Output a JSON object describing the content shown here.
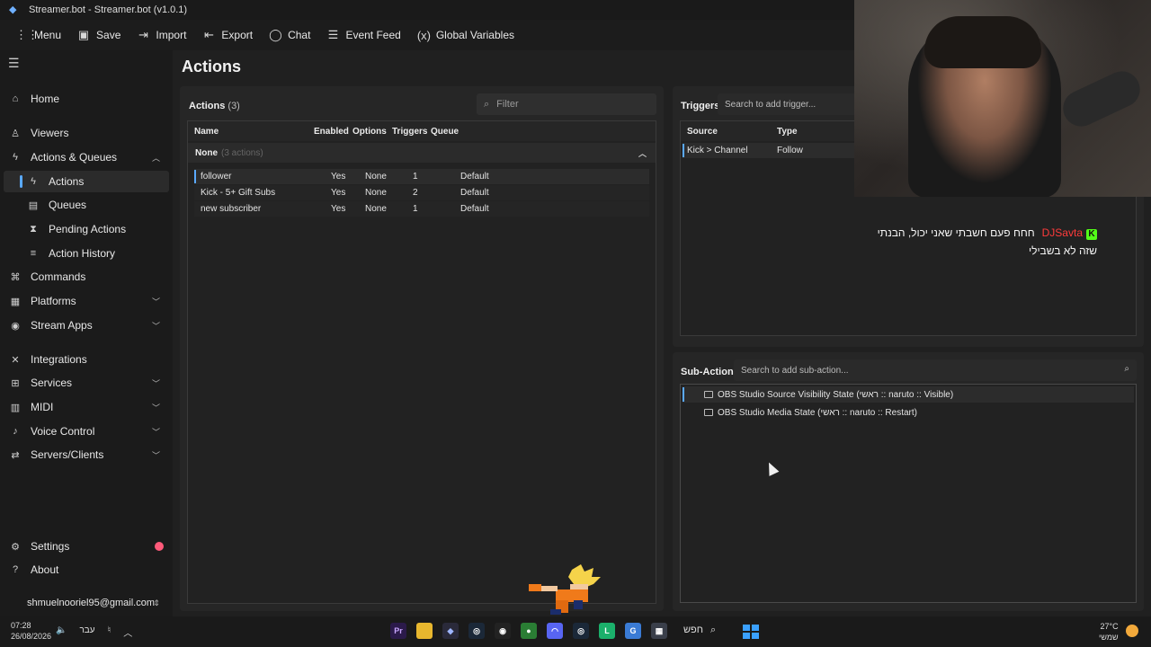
{
  "window": {
    "title": "Streamer.bot - Streamer.bot (v1.0.1)"
  },
  "toolbar": {
    "menu": "Menu",
    "save": "Save",
    "import": "Import",
    "export": "Export",
    "chat": "Chat",
    "event_feed": "Event Feed",
    "global_variables": "Global Variables"
  },
  "sidebar": {
    "items": [
      {
        "label": "Home"
      },
      {
        "label": "Viewers"
      },
      {
        "label": "Actions & Queues"
      },
      {
        "label": "Actions"
      },
      {
        "label": "Queues"
      },
      {
        "label": "Pending Actions"
      },
      {
        "label": "Action History"
      },
      {
        "label": "Commands"
      },
      {
        "label": "Platforms"
      },
      {
        "label": "Stream Apps"
      },
      {
        "label": "Integrations"
      },
      {
        "label": "Services"
      },
      {
        "label": "MIDI"
      },
      {
        "label": "Voice Control"
      },
      {
        "label": "Servers/Clients"
      }
    ],
    "settings": "Settings",
    "about": "About",
    "account": "shmuelnooriel95@gmail.com"
  },
  "page": {
    "title": "Actions"
  },
  "actions_panel": {
    "heading": "Actions",
    "count": "(3)",
    "filter_placeholder": "Filter",
    "columns": [
      "Name",
      "Enabled",
      "Options",
      "Triggers",
      "Queue"
    ],
    "group": {
      "name": "None",
      "count": "(3 actions)"
    },
    "rows": [
      {
        "name": "follower",
        "enabled": "Yes",
        "options": "None",
        "triggers": "1",
        "queue": "Default"
      },
      {
        "name": "Kick - 5+ Gift Subs",
        "enabled": "Yes",
        "options": "None",
        "triggers": "2",
        "queue": "Default"
      },
      {
        "name": "new subscriber",
        "enabled": "Yes",
        "options": "None",
        "triggers": "1",
        "queue": "Default"
      }
    ]
  },
  "triggers_panel": {
    "heading": "Triggers",
    "search_placeholder": "Search to add trigger...",
    "columns": [
      "Source",
      "Type"
    ],
    "rows": [
      {
        "source": "Kick > Channel",
        "type": "Follow"
      }
    ]
  },
  "subactions_panel": {
    "heading": "Sub-Actions",
    "search_placeholder": "Search to add sub-action...",
    "items": [
      {
        "label": "OBS Studio Source Visibility State (ראשי :: naruto :: Visible)"
      },
      {
        "label": "OBS Studio Media State (ראשי :: naruto :: Restart)"
      }
    ]
  },
  "chat_overlay": {
    "user": "DJSavta",
    "badge": "K",
    "message": "חחח פעם חשבתי שאני יכול, הבנתי שזה לא בשבילי",
    "name_color": "#ff3b3b"
  },
  "taskbar": {
    "time": "07:28",
    "date": "26/08/2026",
    "lang": "עבר",
    "search": "חפש",
    "temp": "27°C",
    "weather": "שמשי",
    "apps": [
      "Pr",
      "folder",
      "streamer.bot",
      "steam",
      "obs",
      "chrome",
      "discord",
      "steam",
      "live",
      "g",
      "calc"
    ]
  },
  "colors": {
    "accent": "#5aa9ff",
    "settings_dot": "#ff5a7a",
    "kick_green": "#53fc18"
  }
}
